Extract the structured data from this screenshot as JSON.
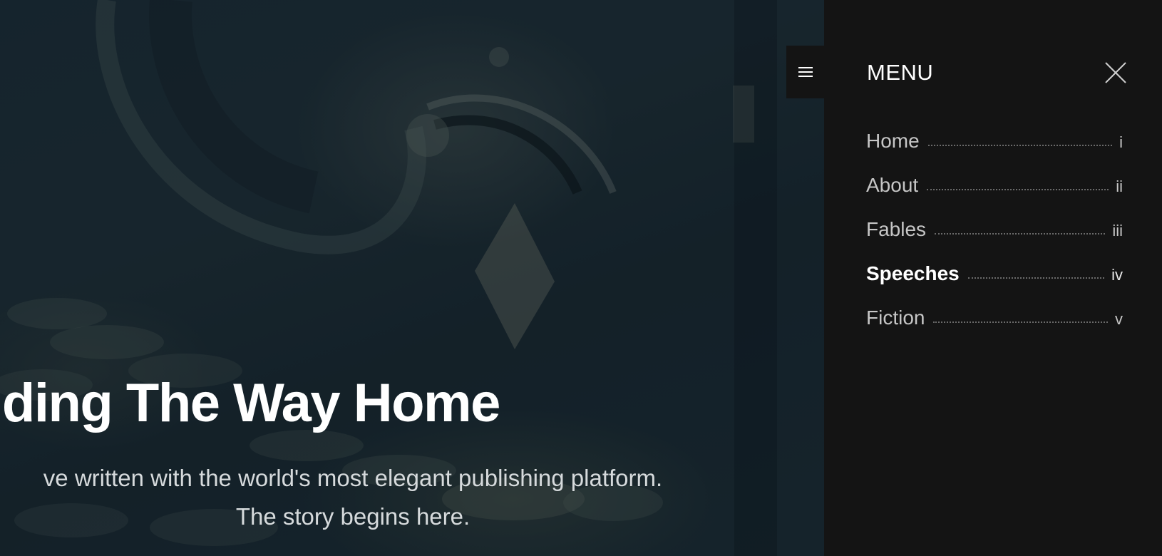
{
  "hero": {
    "title": "nding The Way Home",
    "description_line1": "ve written with the world's most elegant publishing platform.",
    "description_line2": "The story begins here."
  },
  "menu_toggle": {
    "icon": "hamburger-icon"
  },
  "side_menu": {
    "heading": "MENU",
    "close_icon": "close-icon",
    "items": [
      {
        "label": "Home",
        "number": "i",
        "active": false
      },
      {
        "label": "About",
        "number": "ii",
        "active": false
      },
      {
        "label": "Fables",
        "number": "iii",
        "active": false
      },
      {
        "label": "Speeches",
        "number": "iv",
        "active": true
      },
      {
        "label": "Fiction",
        "number": "v",
        "active": false
      }
    ]
  },
  "colors": {
    "menu_background": "#141414",
    "hero_overlay": "#1a2a33",
    "text_primary": "#ffffff",
    "text_muted": "#c6c6c6"
  }
}
